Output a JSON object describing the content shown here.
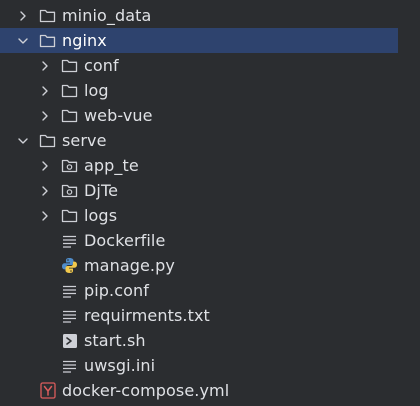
{
  "project_tree": {
    "items": [
      {
        "label": "minio_data",
        "indent": 1,
        "type": "folder",
        "state": "collapsed",
        "icon": "folder-icon"
      },
      {
        "label": "nginx",
        "indent": 1,
        "type": "folder",
        "state": "expanded",
        "selected": true,
        "icon": "folder-icon"
      },
      {
        "label": "conf",
        "indent": 2,
        "type": "folder",
        "state": "collapsed",
        "icon": "folder-icon"
      },
      {
        "label": "log",
        "indent": 2,
        "type": "folder",
        "state": "collapsed",
        "icon": "folder-icon"
      },
      {
        "label": "web-vue",
        "indent": 2,
        "type": "folder",
        "state": "collapsed",
        "icon": "folder-icon"
      },
      {
        "label": "serve",
        "indent": 1,
        "type": "folder",
        "state": "expanded",
        "icon": "folder-icon"
      },
      {
        "label": "app_te",
        "indent": 2,
        "type": "package",
        "state": "collapsed",
        "icon": "python-package-icon"
      },
      {
        "label": "DjTe",
        "indent": 2,
        "type": "package",
        "state": "collapsed",
        "icon": "python-package-icon"
      },
      {
        "label": "logs",
        "indent": 2,
        "type": "folder",
        "state": "collapsed",
        "icon": "folder-icon"
      },
      {
        "label": "Dockerfile",
        "indent": 2,
        "type": "file",
        "icon": "text-file-icon"
      },
      {
        "label": "manage.py",
        "indent": 2,
        "type": "file",
        "icon": "python-file-icon"
      },
      {
        "label": "pip.conf",
        "indent": 2,
        "type": "file",
        "icon": "text-file-icon"
      },
      {
        "label": "requirments.txt",
        "indent": 2,
        "type": "file",
        "icon": "text-file-icon"
      },
      {
        "label": "start.sh",
        "indent": 2,
        "type": "file",
        "icon": "shell-script-icon"
      },
      {
        "label": "uwsgi.ini",
        "indent": 2,
        "type": "file",
        "icon": "text-file-icon"
      },
      {
        "label": "docker-compose.yml",
        "indent": 1,
        "type": "file",
        "icon": "yaml-file-icon"
      }
    ]
  },
  "colors": {
    "background": "#2b2d30",
    "selection": "#2e436e",
    "text": "#dfe1e5",
    "icon_outline": "#ced0d6",
    "python_blue": "#4f8cc9",
    "python_yellow": "#f2c94c",
    "yaml_red": "#db5c5c"
  }
}
